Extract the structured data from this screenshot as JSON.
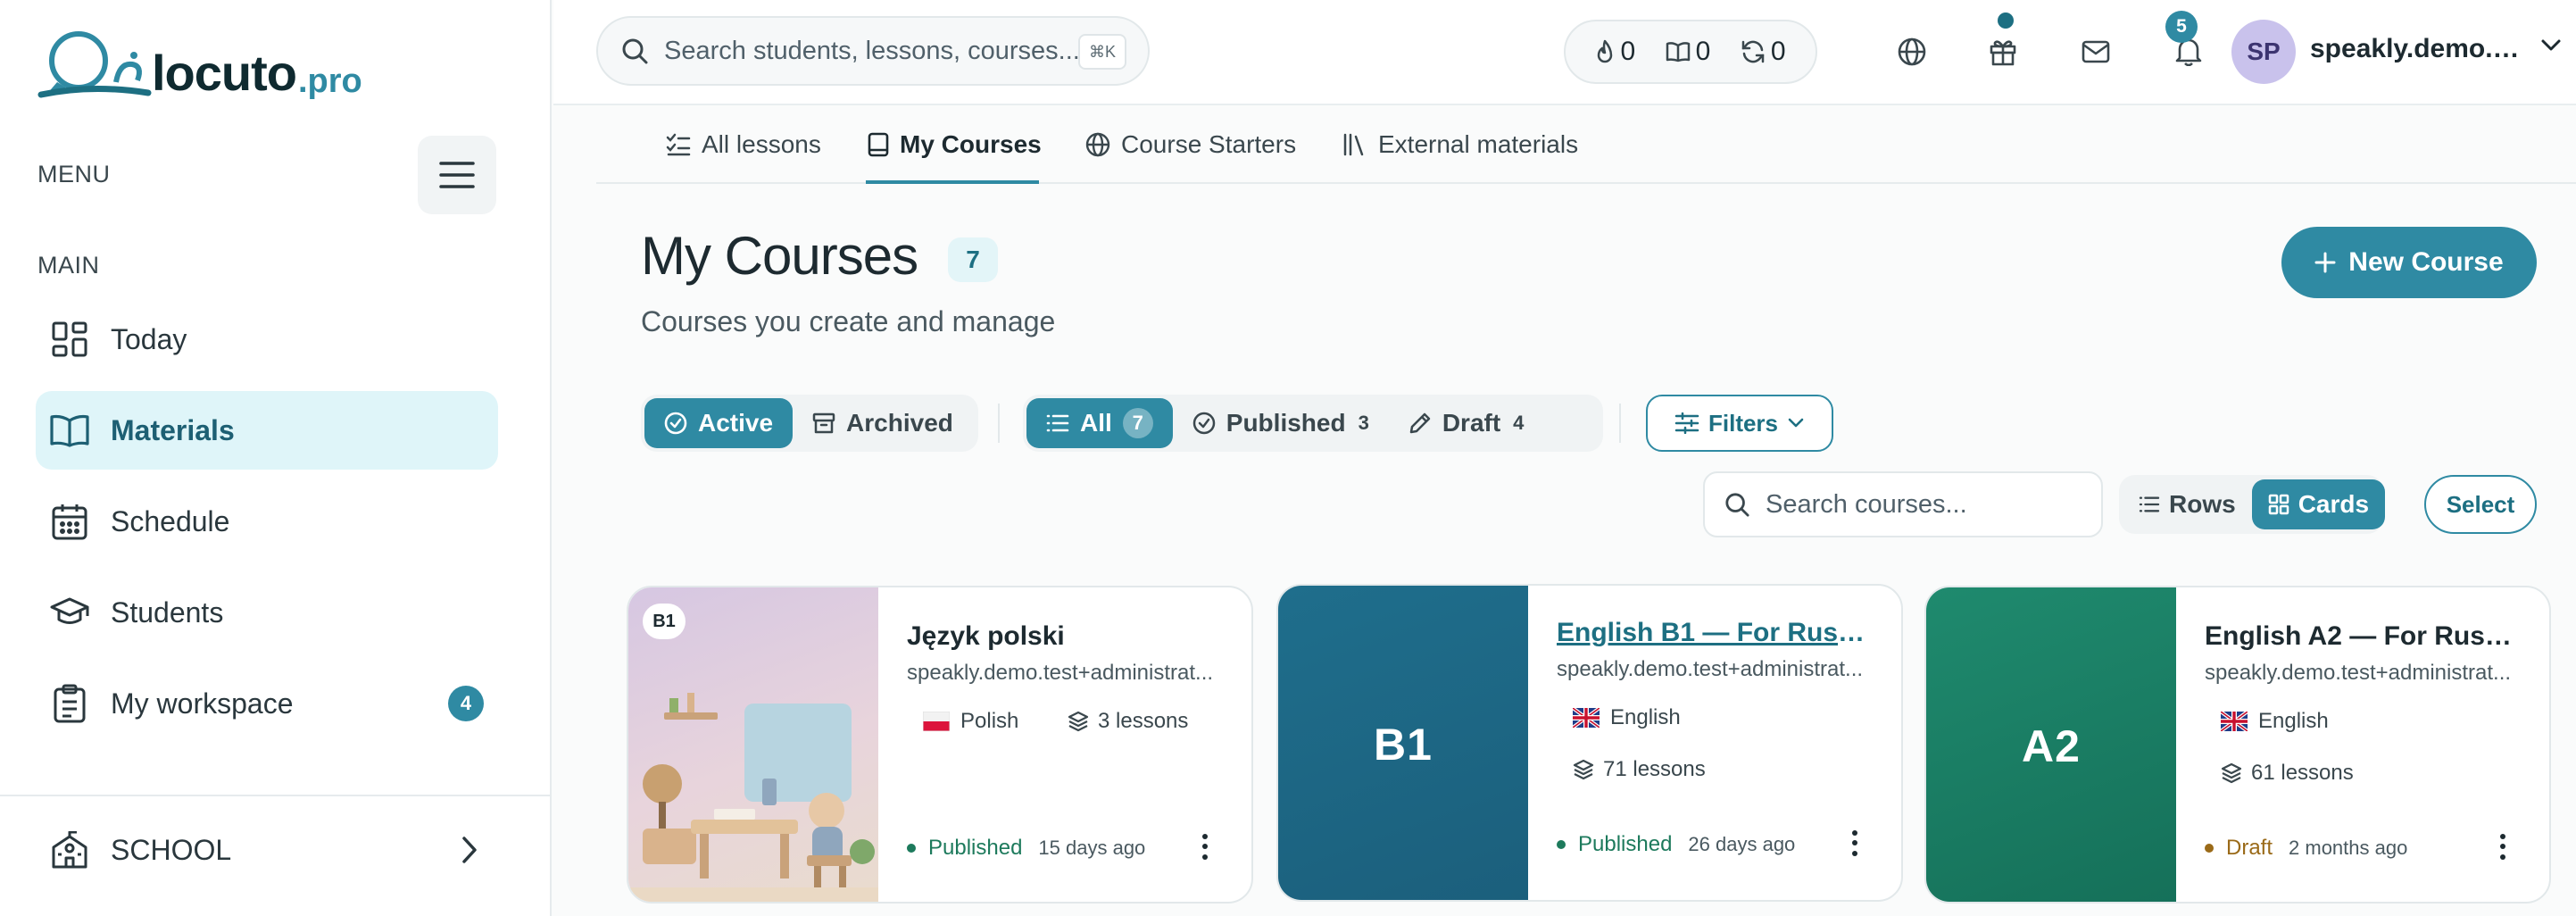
{
  "brand": {
    "name": "locuto",
    "tld": ".pro"
  },
  "sidebar": {
    "menu_label": "MENU",
    "section_label": "MAIN",
    "items": [
      {
        "label": "Today",
        "icon": "dashboard-icon"
      },
      {
        "label": "Materials",
        "icon": "book-open-icon",
        "active": true
      },
      {
        "label": "Schedule",
        "icon": "calendar-icon"
      },
      {
        "label": "Students",
        "icon": "graduation-cap-icon"
      },
      {
        "label": "My workspace",
        "icon": "clipboard-icon",
        "badge": "4"
      }
    ],
    "school_label": "SCHOOL"
  },
  "topbar": {
    "search_placeholder": "Search students, lessons, courses...",
    "search_shortcut": "⌘K",
    "stats": [
      {
        "icon": "flame-icon",
        "value": "0"
      },
      {
        "icon": "book-icon",
        "value": "0"
      },
      {
        "icon": "refresh-icon",
        "value": "0"
      }
    ],
    "notification_count": "5",
    "avatar_initials": "SP",
    "username": "speakly.demo.te..."
  },
  "tabs": [
    {
      "label": "All lessons",
      "icon": "list-check-icon"
    },
    {
      "label": "My Courses",
      "icon": "notebook-icon",
      "active": true
    },
    {
      "label": "Course Starters",
      "icon": "globe-icon"
    },
    {
      "label": "External materials",
      "icon": "library-icon"
    }
  ],
  "page": {
    "title": "My Courses",
    "count": "7",
    "subtitle": "Courses you create and manage",
    "new_button": "New Course"
  },
  "filters": {
    "state": [
      {
        "label": "Active",
        "active": true
      },
      {
        "label": "Archived"
      }
    ],
    "status": [
      {
        "label": "All",
        "count": "7",
        "active": true
      },
      {
        "label": "Published",
        "count": "3"
      },
      {
        "label": "Draft",
        "count": "4"
      }
    ],
    "filters_label": "Filters",
    "course_search_placeholder": "Search courses...",
    "view_modes": [
      {
        "label": "Rows"
      },
      {
        "label": "Cards",
        "active": true
      }
    ],
    "select_label": "Select"
  },
  "courses": [
    {
      "title": "Język polski",
      "owner": "speakly.demo.test+administrat...",
      "language": "Polish",
      "lessons": "3 lessons",
      "status": "Published",
      "date": "15 days ago",
      "level_chip": "B1",
      "status_color": "#1d7a5c"
    },
    {
      "title": "English B1 — For Russian...",
      "owner": "speakly.demo.test+administrat...",
      "language": "English",
      "lessons": "71 lessons",
      "status": "Published",
      "date": "26 days ago",
      "level": "B1",
      "status_color": "#1d7a5c"
    },
    {
      "title": "English A2 — For Russia...",
      "owner": "speakly.demo.test+administrat...",
      "language": "English",
      "lessons": "61 lessons",
      "status": "Draft",
      "date": "2 months ago",
      "level": "A2",
      "status_color": "#9a6a18"
    }
  ],
  "colors": {
    "accent": "#2f8aa3",
    "accent_dark": "#1d6f82",
    "active_nav_bg": "#dff5f9"
  }
}
